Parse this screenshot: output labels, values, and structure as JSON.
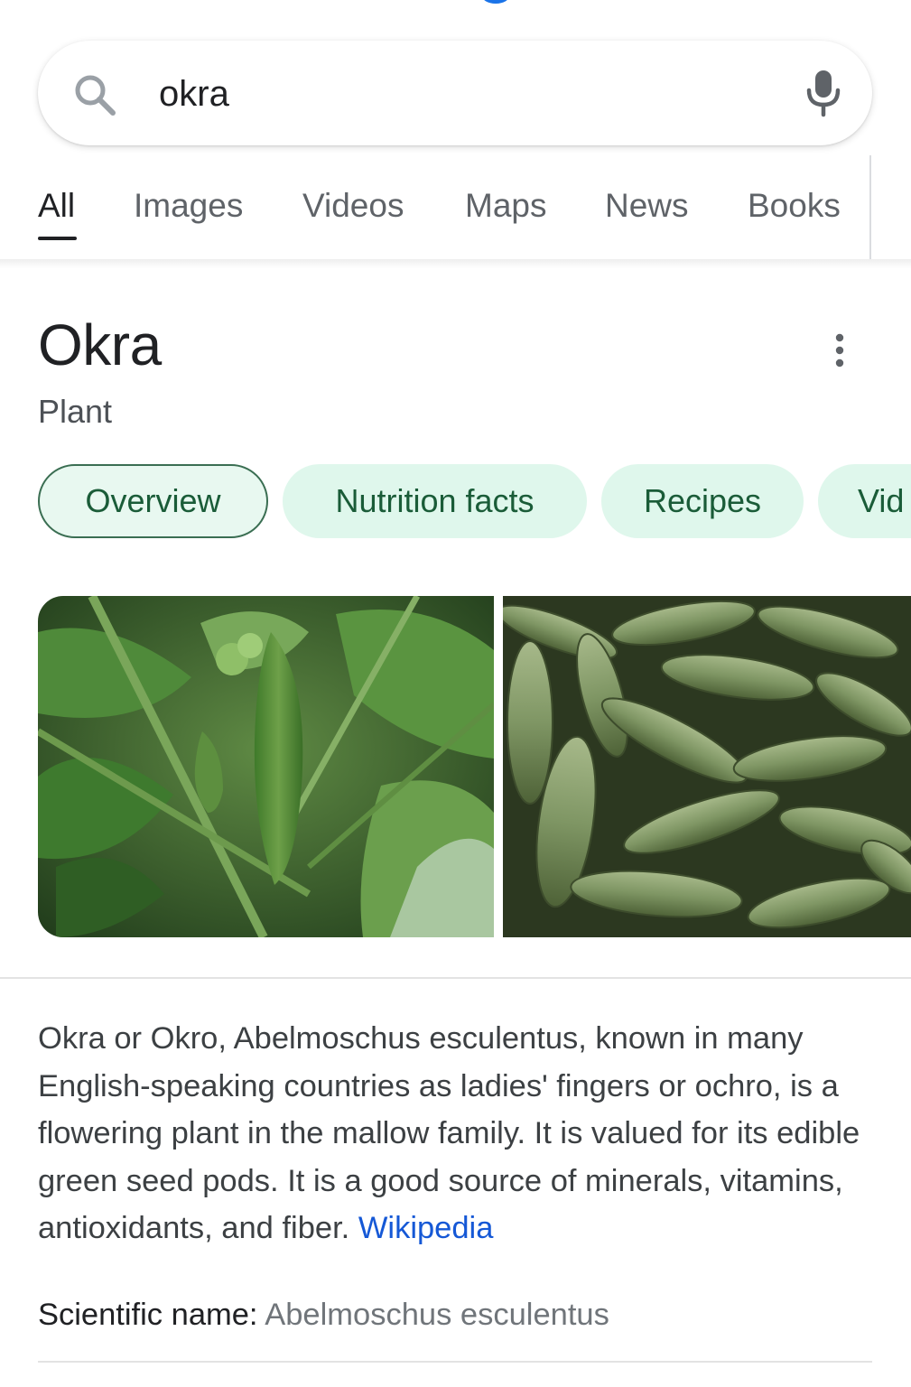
{
  "search": {
    "query": "okra"
  },
  "tabs": [
    {
      "label": "All",
      "active": true
    },
    {
      "label": "Images"
    },
    {
      "label": "Videos"
    },
    {
      "label": "Maps"
    },
    {
      "label": "News"
    },
    {
      "label": "Books"
    }
  ],
  "knowledge_panel": {
    "title": "Okra",
    "subtitle": "Plant",
    "chips": [
      {
        "label": "Overview",
        "selected": true
      },
      {
        "label": "Nutrition facts"
      },
      {
        "label": "Recipes"
      },
      {
        "label": "Vid"
      }
    ],
    "description": "Okra or Okro, Abelmoschus esculentus, known in many English-speaking countries as ladies' fingers or ochro, is a flowering plant in the mallow family. It is valued for its edible green seed pods. It is a good source of minerals, vitamins, antioxidants, and fiber.",
    "source_link": "Wikipedia",
    "facts": {
      "scientific_name_label": "Scientific name:",
      "scientific_name_value": "Abelmoschus esculentus"
    }
  },
  "colors": {
    "accent_blue": "#1a73e8",
    "chip_bg": "#dff7ec",
    "chip_text": "#1a5c38",
    "link": "#1558d6"
  },
  "icons": {
    "search": "search-icon",
    "mic": "microphone-icon",
    "more": "more-vert-icon"
  }
}
